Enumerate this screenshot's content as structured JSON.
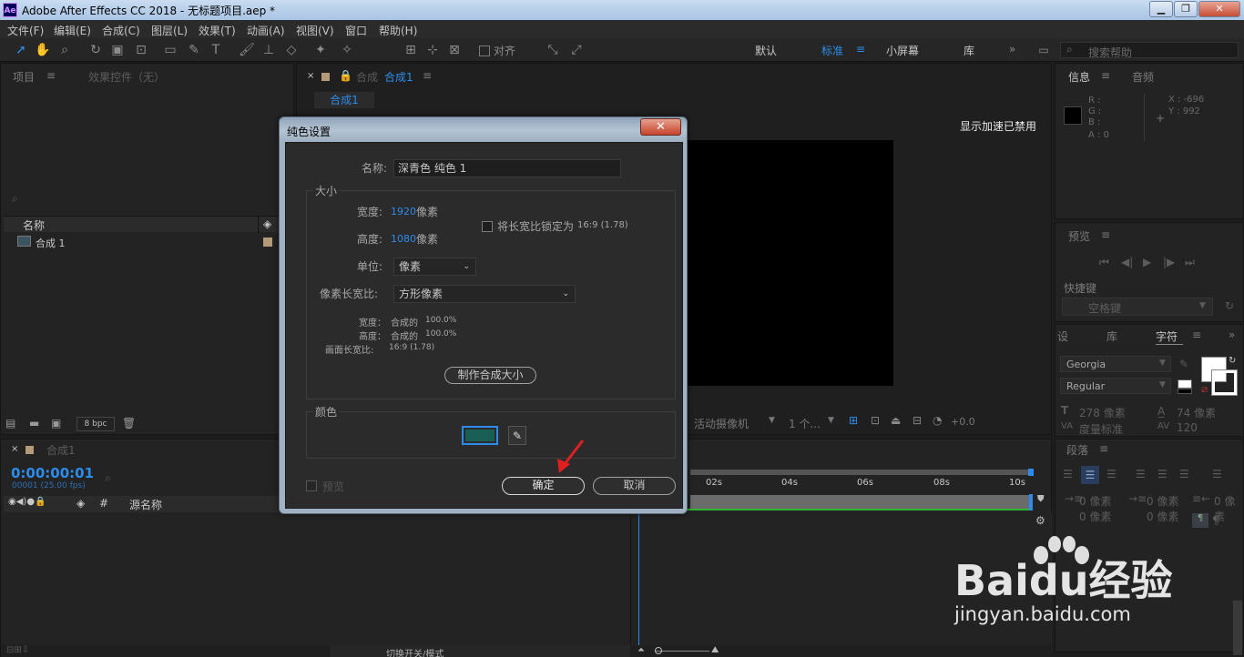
{
  "window": {
    "app_icon": "Ae",
    "title": "Adobe After Effects CC 2018 - 无标题项目.aep *",
    "minimize": "▁",
    "maximize": "❐",
    "close": "✕"
  },
  "menu": [
    "文件(F)",
    "编辑(E)",
    "合成(C)",
    "图层(L)",
    "效果(T)",
    "动画(A)",
    "视图(V)",
    "窗口",
    "帮助(H)"
  ],
  "toolbar": {
    "align_label": "对齐",
    "workspaces": [
      "默认",
      "标准",
      "小屏幕",
      "库"
    ],
    "active_workspace": "标准",
    "search_placeholder": "搜索帮助",
    "more": "»"
  },
  "project_panel": {
    "tab_project": "项目",
    "tab_effects": "效果控件（无）",
    "col_name": "名称",
    "items": [
      {
        "name": "合成 1"
      }
    ],
    "bpc": "8 bpc"
  },
  "comp_panel": {
    "tab_prefix": "合成",
    "tab_name": "合成1",
    "subtab": "合成1",
    "gpu_notice": "显示加速已禁用",
    "bottom_camera": "活动摄像机",
    "bottom_views": "1 个...",
    "bottom_exposure": "+0.0"
  },
  "info_panel": {
    "tab_info": "信息",
    "tab_audio": "音频",
    "r": "R :",
    "g": "G :",
    "b": "B :",
    "a": "A : 0",
    "x": "X : -696",
    "y": "Y : 992"
  },
  "preview_panel": {
    "title": "预览",
    "shortcut_label": "快捷键",
    "shortcut_value": "空格键"
  },
  "char_panel": {
    "tab_left": "设",
    "tab_lib": "库",
    "tab_char": "字符",
    "font": "Georgia",
    "style": "Regular",
    "size": "278 像素",
    "tracking": "74 像素",
    "metric": "度量标准",
    "scale": "120"
  },
  "para_panel": {
    "title": "段落",
    "indent1": "0 像素",
    "indent2": "0 像素",
    "indent3": "0 像素",
    "indent4": "0 像素",
    "indent5": "0 像素"
  },
  "timeline": {
    "comp_name": "合成1",
    "timecode": "0:00:00:01",
    "frame_info": "00001 (25.00 fps)",
    "col_hash": "#",
    "col_source": "源名称",
    "ticks": [
      "02s",
      "04s",
      "06s",
      "08s",
      "10s"
    ],
    "bottom_label": "切换开关/模式"
  },
  "dialog": {
    "title": "纯色设置",
    "close": "✕",
    "name_label": "名称:",
    "name_value": "深青色 纯色 1",
    "size_group": "大小",
    "width_label": "宽度:",
    "width_value": "1920",
    "height_label": "高度:",
    "height_value": "1080",
    "px_unit": "像素",
    "lock_label": "将长宽比锁定为",
    "lock_ratio": "16:9 (1.78)",
    "units_label": "单位:",
    "units_value": "像素",
    "par_label": "像素长宽比:",
    "par_value": "方形像素",
    "pct_width_label": "宽度：",
    "pct_width_value": "合成的",
    "pct_width_num": "100.0%",
    "pct_height_label": "高度：",
    "pct_height_value": "合成的",
    "pct_height_num": "100.0%",
    "frame_ratio_label": "画面长宽比:",
    "frame_ratio_value": "16:9 (1.78)",
    "make_comp_size": "制作合成大小",
    "color_group": "颜色",
    "swatch_color": "#1a5f56",
    "preview_label": "预览",
    "ok": "确定",
    "cancel": "取消"
  },
  "watermark": {
    "brand": "Baidu经验",
    "url": "jingyan.baidu.com"
  }
}
